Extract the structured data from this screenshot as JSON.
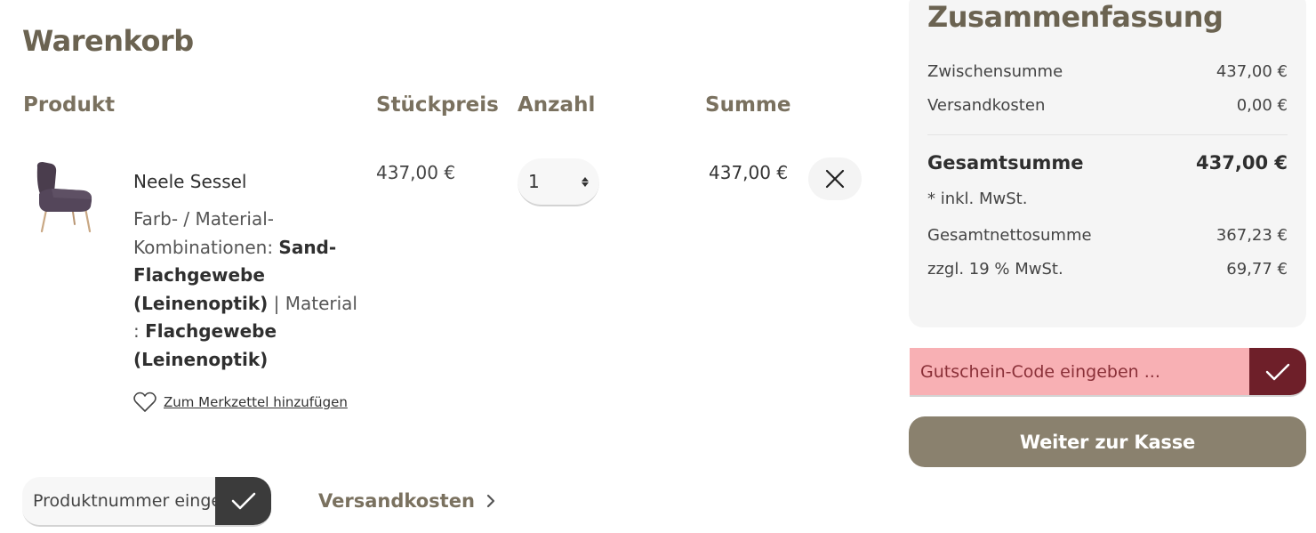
{
  "cart": {
    "title": "Warenkorb",
    "columns": {
      "product": "Produkt",
      "unit_price": "Stückpreis",
      "quantity": "Anzahl",
      "sum": "Summe"
    },
    "item": {
      "name": "Neele Sessel",
      "option1_label": "Farb- / Material-Kombinationen: ",
      "option1_value": "Sand-Flachgewebe (Leinenoptik)",
      "separator": " | ",
      "option2_label": "Material : ",
      "option2_value": "Flachgewebe (Leinenoptik)",
      "wishlist_label": "Zum Merkzettel hinzufügen",
      "unit_price": "437,00 €",
      "quantity": "1",
      "line_total": "437,00 €"
    },
    "product_number": {
      "placeholder": "Produktnummer eingeben ..."
    },
    "shipping_link": "Versandkosten"
  },
  "summary": {
    "title": "Zusammenfassung",
    "subtotal_label": "Zwischensumme",
    "subtotal_value": "437,00 €",
    "shipping_label": "Versandkosten",
    "shipping_value": "0,00 €",
    "total_label": "Gesamtsumme",
    "total_value": "437,00 €",
    "vat_note": "* inkl. MwSt.",
    "net_label": "Gesamtnettosumme",
    "net_value": "367,23 €",
    "tax_label": "zzgl. 19 % MwSt.",
    "tax_value": "69,77 €",
    "voucher_placeholder": "Gutschein-Code eingeben ...",
    "checkout_label": "Weiter zur Kasse"
  },
  "colors": {
    "heading": "#6b6351",
    "accent": "#8a816e",
    "voucher_bg": "#f8b0b4",
    "voucher_button": "#6e1f29",
    "dark_button": "#3b3b3b"
  },
  "icons": {
    "product_image": "armchair-image",
    "remove": "close-icon",
    "wishlist": "heart-icon",
    "submit": "check-icon",
    "chevron": "chevron-right-icon"
  }
}
